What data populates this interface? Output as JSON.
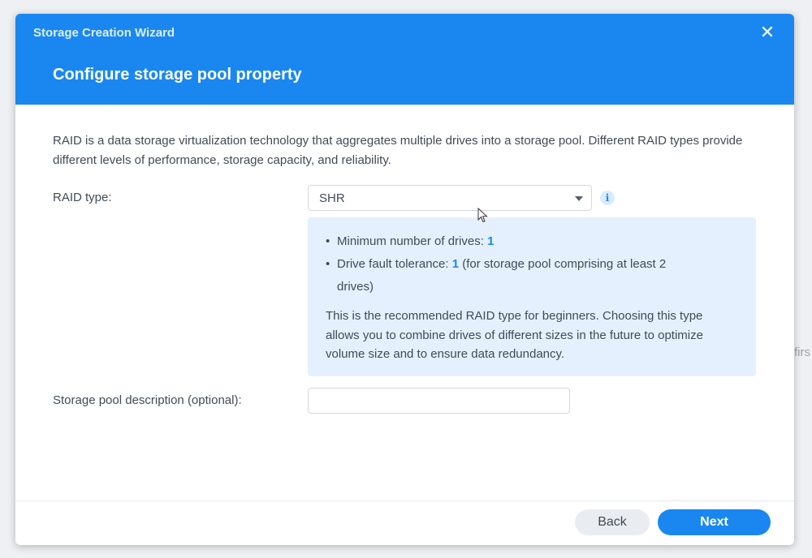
{
  "background": {
    "partial_text": "firs"
  },
  "dialog": {
    "window_title": "Storage Creation Wizard",
    "step_title": "Configure storage pool property",
    "close_icon": "close-icon",
    "description": "RAID is a data storage virtualization technology that aggregates multiple drives into a storage pool. Different RAID types provide different levels of performance, storage capacity, and reliability.",
    "raid_type": {
      "label": "RAID type:",
      "selected": "SHR",
      "info_icon": "info-icon"
    },
    "info_panel": {
      "min_drives_label": "Minimum number of drives:",
      "min_drives_value": "1",
      "fault_tolerance_label": "Drive fault tolerance:",
      "fault_tolerance_value": "1",
      "fault_tolerance_note": "(for storage pool comprising at least 2",
      "fault_tolerance_note_cont": "drives)",
      "recommendation": "This is the recommended RAID type for beginners. Choosing this type allows you to combine drives of different sizes in the future to optimize volume size and to ensure data redundancy."
    },
    "pool_description": {
      "label": "Storage pool description (optional):",
      "value": ""
    },
    "buttons": {
      "back": "Back",
      "next": "Next"
    }
  },
  "colors": {
    "accent": "#1a87f0",
    "info_panel_bg": "#e4f0fd",
    "text": "#414b55"
  }
}
